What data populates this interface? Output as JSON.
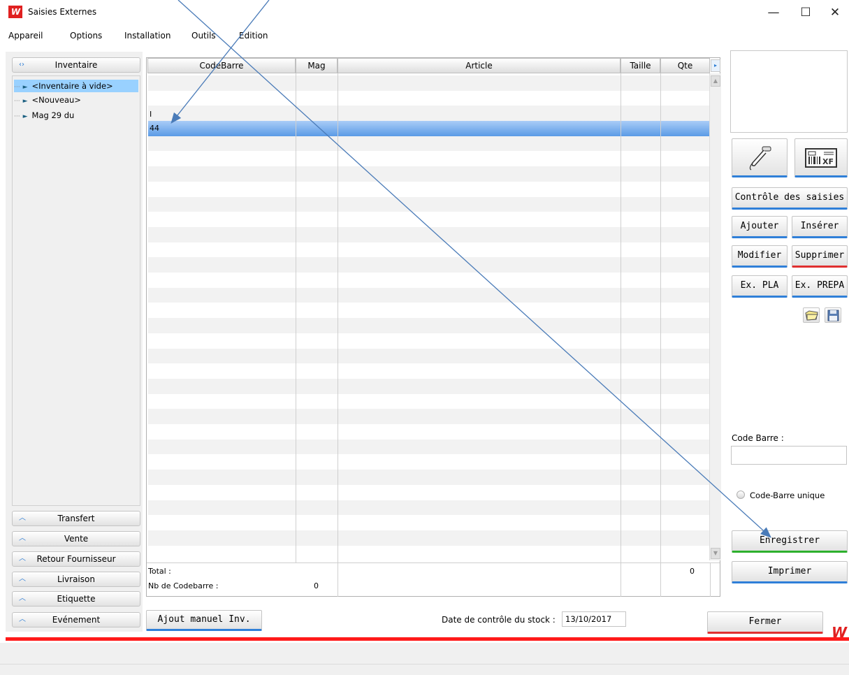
{
  "window": {
    "title": "Saisies Externes",
    "logo": "W",
    "minimize": "—",
    "maximize": "☐",
    "close": "✕"
  },
  "menu": [
    "Appareil",
    "Options",
    "Installation",
    "Outils",
    "Edition"
  ],
  "left": {
    "active_section": "Inventaire",
    "tree": [
      "<Inventaire à vide>",
      "<Nouveau>",
      "Mag 29 du"
    ],
    "sections": [
      "Transfert",
      "Vente",
      "Retour Fournisseur",
      "Livraison",
      "Etiquette",
      "Evénement"
    ]
  },
  "grid": {
    "columns": [
      "CodeBarre",
      "Mag",
      "Article",
      "Taille",
      "Qte"
    ],
    "rows": [
      [
        "I",
        "",
        "",
        "",
        ""
      ],
      [
        "44",
        "",
        "",
        "",
        ""
      ]
    ],
    "selected_row": 1,
    "footer": {
      "total_label": "Total :",
      "total_qte": "0",
      "nb_label": "Nb de Codebarre :",
      "nb_value": "0"
    }
  },
  "right": {
    "controle": "Contrôle des saisies",
    "ajouter": "Ajouter",
    "inserer": "Insérer",
    "modifier": "Modifier",
    "supprimer": "Supprimer",
    "ex_pla": "Ex. PLA",
    "ex_prepa": "Ex. PREPA",
    "code_barre_label": "Code Barre :",
    "code_barre_value": "",
    "unique_label": "Code-Barre unique",
    "enregistrer": "Enregistrer",
    "imprimer": "Imprimer"
  },
  "bottom": {
    "ajout": "Ajout manuel Inv.",
    "date_label": "Date de contrôle du stock :",
    "date_value": "13/10/2017",
    "fermer": "Fermer"
  },
  "colors": {
    "accent": "#2f7fd8",
    "brand_red": "#ff1a1a",
    "selection": "#99d1ff"
  }
}
